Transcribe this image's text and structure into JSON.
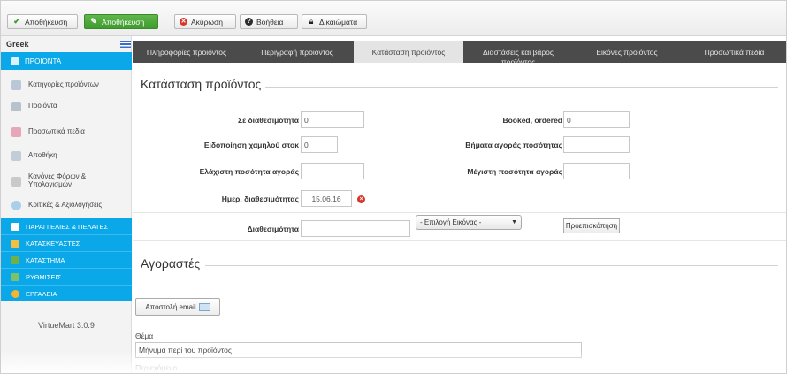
{
  "toolbar": {
    "buttons": [
      {
        "label": "Αποθήκευση",
        "icon": "check-icon"
      },
      {
        "label": "Αποθήκευση",
        "icon": "edit-icon"
      },
      {
        "label": "Ακύρωση",
        "icon": "cancel-icon"
      },
      {
        "label": "Βοήθεια",
        "icon": "help-icon"
      },
      {
        "label": "Δικαιώματα",
        "icon": "lock-icon"
      }
    ]
  },
  "sidebar": {
    "language": "Greek",
    "section_title": "ΠΡΟΙΟΝΤΑ",
    "items": [
      {
        "label": "Κατηγορίες προϊόντων",
        "icon_color": "#b9c7d6"
      },
      {
        "label": "Προϊόντα",
        "icon_color": "#b7c2cc"
      },
      {
        "label": "Προσωπικά πεδία",
        "icon_color": "#e6a7b8"
      },
      {
        "label": "Αποθήκη",
        "icon_color": "#c3cdd7"
      },
      {
        "label": "Κανόνες Φόρων & Υπολογισμών",
        "icon_color": "#c9c9c9"
      },
      {
        "label": "Κριτικές & Αξιολογήσεις",
        "icon_color": "#a9d0e8"
      }
    ],
    "sections": [
      {
        "label": "ΠΑΡΑΓΓΕΛΙΕΣ & ΠΕΛΑΤΕΣ",
        "icon_color": "#ffffff"
      },
      {
        "label": "ΚΑΤΑΣΚΕΥΑΣΤΕΣ",
        "icon_color": "#f0c040"
      },
      {
        "label": "ΚΑΤΑΣΤΗΜΑ",
        "icon_color": "#6fb04a"
      },
      {
        "label": "ΡΥΘΜΙΣΕΙΣ",
        "icon_color": "#7bc26a"
      },
      {
        "label": "ΕΡΓΑΛΕΙΑ",
        "icon_color": "#f5b62e"
      }
    ],
    "version": "VirtueMart 3.0.9"
  },
  "tabs": [
    {
      "label": "Πληροφορίες προϊόντος",
      "active": false
    },
    {
      "label": "Περιγραφή προϊόντος",
      "active": false
    },
    {
      "label": "Κατάσταση προϊόντος",
      "active": true
    },
    {
      "label": "Διαστάσεις και βάρος προϊόντος",
      "active": false
    },
    {
      "label": "Εικόνες προϊόντος",
      "active": false
    },
    {
      "label": "Προσωπικά πεδία",
      "active": false
    }
  ],
  "status": {
    "legend": "Κατάσταση προϊόντος",
    "in_stock_label": "Σε διαθεσιμότητα",
    "in_stock_value": "0",
    "booked_label": "Booked, ordered",
    "booked_value": "0",
    "low_stock_label": "Ειδοποίηση χαμηλού στοκ",
    "low_stock_value": "0",
    "step_label": "Βήματα αγοράς ποσότητας",
    "step_value": "",
    "min_qty_label": "Ελάχιστη ποσότητα αγοράς",
    "min_qty_value": "",
    "max_qty_label": "Μέγιστη ποσότητα αγοράς",
    "max_qty_value": "",
    "avail_date_label": "Ημερ. διαθεσιμότητας",
    "avail_date_value": "15.06.16",
    "availability_label": "Διαθεσιμότητα",
    "availability_value": "",
    "image_select": "- Επιλογή Εικόνας -",
    "preview_button": "Προεπισκόπηση"
  },
  "buyers": {
    "legend": "Αγοραστές",
    "send_email_button": "Αποστολή email",
    "subject_label": "Θέμα",
    "subject_value": "Μήνυμα περί του προϊόντος",
    "content_label": "Περιεχόμενο"
  },
  "colors": {
    "accent": "#0aa8e8",
    "tab_bar": "#4b4b4b",
    "save_green": "#4aa83a",
    "cancel_red": "#d9362b"
  }
}
